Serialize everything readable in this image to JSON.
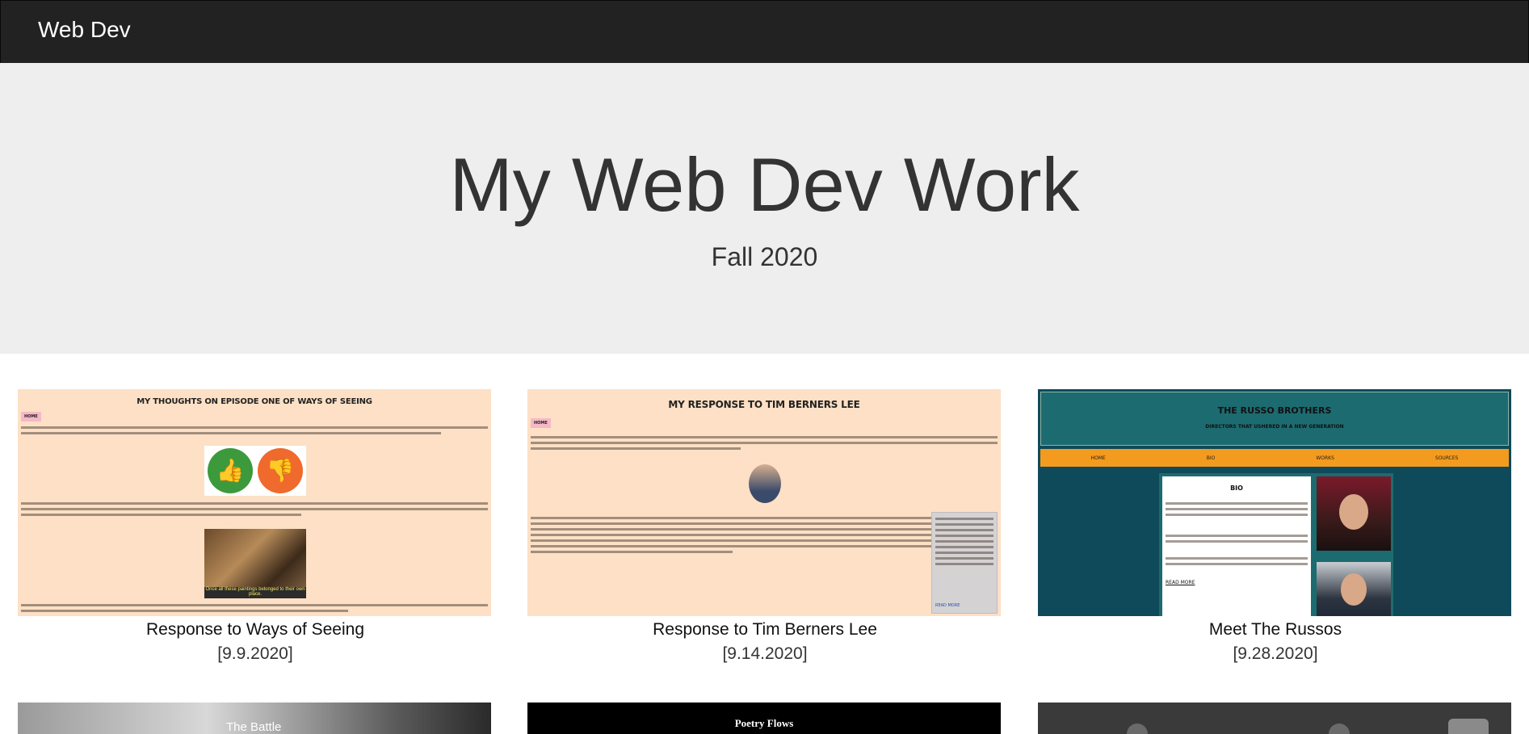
{
  "navbar": {
    "brand": "Web Dev"
  },
  "hero": {
    "title": "My Web Dev Work",
    "subtitle": "Fall 2020"
  },
  "projects": [
    {
      "title": "Response to Ways of Seeing",
      "date": "[9.9.2020]",
      "thumb": {
        "heading": "MY THOUGHTS ON EPISODE ONE OF WAYS OF SEEING",
        "home": "HOME",
        "caption": "Once all these paintings belonged to their own place."
      }
    },
    {
      "title": "Response to Tim Berners Lee",
      "date": "[9.14.2020]",
      "thumb": {
        "heading": "MY RESPONSE TO TIM BERNERS LEE",
        "home": "HOME",
        "aside_link": "READ MORE"
      }
    },
    {
      "title": "Meet The Russos",
      "date": "[9.28.2020]",
      "thumb": {
        "heading": "THE RUSSO BROTHERS",
        "tagline": "DIRECTORS THAT USHERED IN A NEW GENERATION",
        "nav": [
          "HOME",
          "BIO",
          "WORKS",
          "SOURCES"
        ],
        "bio_title": "BIO",
        "read_more": "READ MORE"
      }
    }
  ],
  "row2": [
    {
      "label": "The Battle"
    },
    {
      "label": "Poetry Flows"
    },
    {
      "label": ""
    }
  ],
  "colors": {
    "navbar": "#222222",
    "hero_bg": "#eeeeee",
    "peach": "#fde0c5",
    "teal": "#1c6b70",
    "orange": "#f39b1f"
  }
}
